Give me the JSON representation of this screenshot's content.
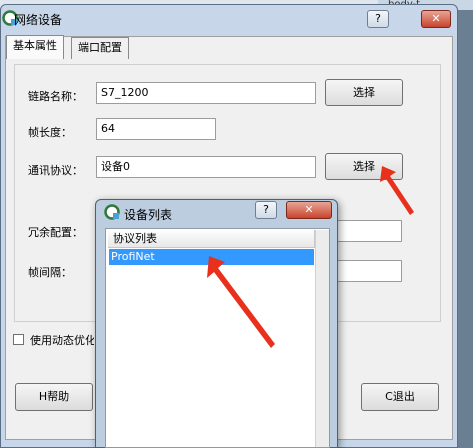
{
  "background": {
    "tab_label": "body-t..."
  },
  "dialog": {
    "title": "网络设备",
    "help_btn": "?",
    "close_btn": "✕",
    "tabs": [
      {
        "label": "基本属性",
        "active": true
      },
      {
        "label": "端口配置",
        "active": false
      }
    ],
    "fields": {
      "link_name_label": "链路名称：",
      "link_name_value": "S7_1200",
      "link_name_button": "选择",
      "frame_length_label": "帧长度：",
      "frame_length_value": "64",
      "protocol_label": "通讯协议：",
      "protocol_value": "设备0",
      "protocol_button": "选择",
      "redundancy_label": "冗余配置：",
      "frame_interval_label": "帧间隔："
    },
    "checkbox_label": "使用动态优化",
    "help_button": "H帮助",
    "exit_button": "C退出"
  },
  "device_list": {
    "title": "设备列表",
    "help_btn": "?",
    "close_btn": "✕",
    "column_header": "协议列表",
    "items": [
      "ProfiNet"
    ]
  },
  "annotation_color": "#e8301c"
}
